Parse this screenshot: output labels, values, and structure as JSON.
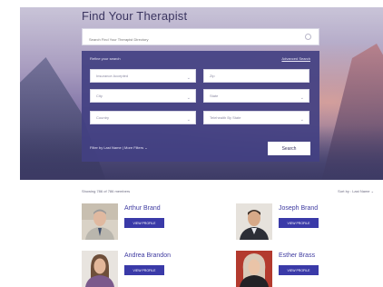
{
  "header": {
    "title": "Find Your Therapist"
  },
  "search": {
    "placeholder": "Search Find Your Therapist Directory"
  },
  "panel": {
    "refine_label": "Refine your search",
    "advanced_link": "Advanced Search",
    "fields": [
      {
        "value": "Insurance Accepted",
        "dropdown": true
      },
      {
        "value": "Zip",
        "dropdown": false
      },
      {
        "value": "City",
        "dropdown": true
      },
      {
        "value": "State",
        "dropdown": true
      },
      {
        "value": "Country",
        "dropdown": true
      },
      {
        "value": "Telehealth By State",
        "dropdown": true
      }
    ],
    "filter_by_last_name": "Filter by Last Name",
    "separator": "|",
    "more_filters": "More Filters",
    "search_button": "Search"
  },
  "results": {
    "count_text": "Showing 786 of 786 members",
    "sort_text": "Sort by : Last Name"
  },
  "therapists": [
    {
      "name": "Arthur Brand",
      "button": "VIEW PROFILE"
    },
    {
      "name": "Joseph Brand",
      "button": "VIEW PROFILE"
    },
    {
      "name": "Andrea Brandon",
      "button": "VIEW PROFILE"
    },
    {
      "name": "Esther Brass",
      "button": "VIEW PROFILE"
    }
  ],
  "icons": {
    "search": "search-icon",
    "chevron": "chevron-down-icon",
    "avatar": "avatar"
  },
  "colors": {
    "accent": "#3a3aa8",
    "panel": "#42408a",
    "link": "#3e3aa0"
  }
}
